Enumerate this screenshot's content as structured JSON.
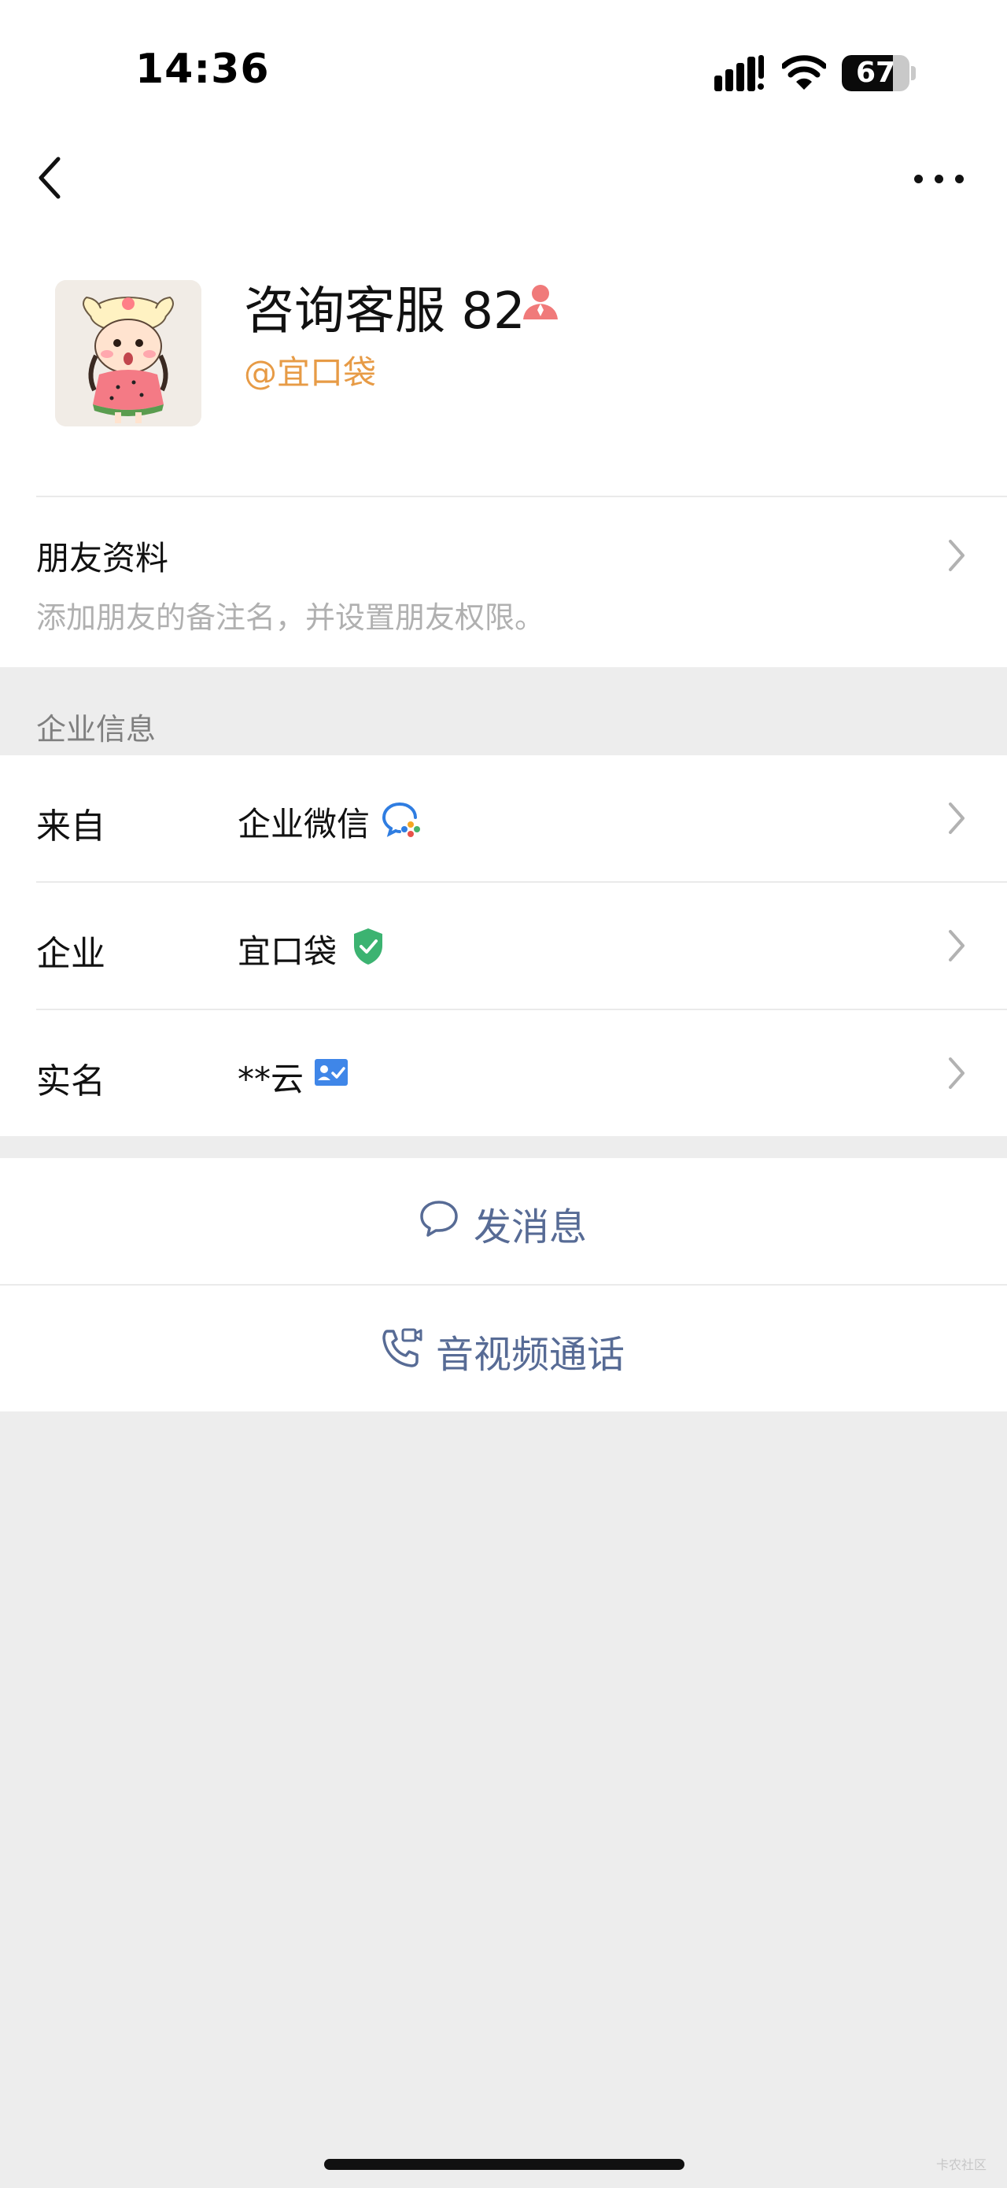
{
  "status_bar": {
    "time": "14:36",
    "battery_level": "67"
  },
  "nav": {
    "back_icon": "chevron-left-icon",
    "more_icon": "more-dots-icon"
  },
  "profile": {
    "name": "咨询客服 82",
    "org_tag": "@宜口袋",
    "gender_icon": "female-icon",
    "gender_color": "#f07a7a"
  },
  "friend_info": {
    "title": "朋友资料",
    "subtitle": "添加朋友的备注名，并设置朋友权限。"
  },
  "enterprise": {
    "section_title": "企业信息",
    "rows": [
      {
        "label": "来自",
        "value": "企业微信",
        "icon": "wecom-icon"
      },
      {
        "label": "企业",
        "value": "宜口袋",
        "icon": "verified-shield-icon"
      },
      {
        "label": "实名",
        "value": "**云",
        "icon": "id-card-icon"
      }
    ]
  },
  "actions": {
    "send_message": "发消息",
    "av_call": "音视频通话",
    "link_color": "#576b95"
  },
  "watermark": "卡农社区"
}
